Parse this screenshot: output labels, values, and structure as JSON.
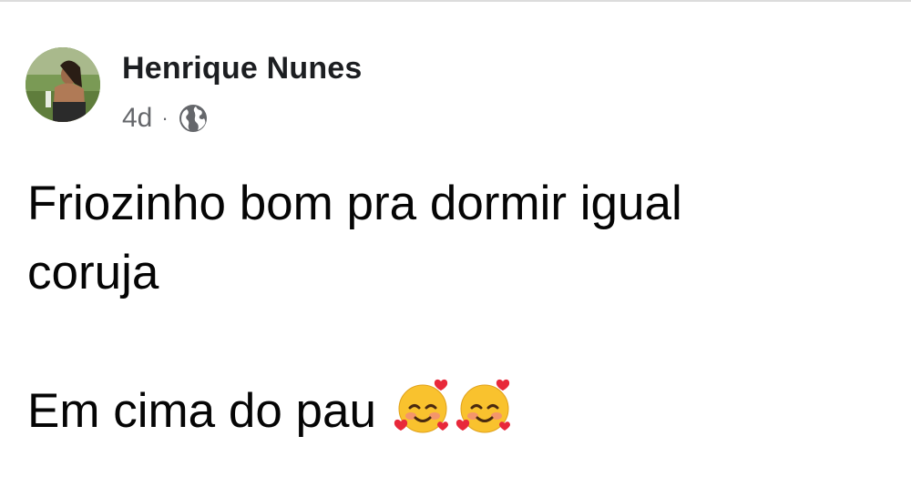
{
  "post": {
    "author_name": "Henrique Nunes",
    "timestamp": "4d",
    "separator": "·",
    "audience_icon": "globe-icon",
    "text_lines": [
      "Friozinho bom pra dormir igual",
      "coruja",
      "",
      "Em cima do pau"
    ],
    "emojis": [
      "smiling-face-with-hearts",
      "smiling-face-with-hearts"
    ]
  },
  "colors": {
    "name": "#1c1e21",
    "meta": "#65676b",
    "body_text": "#050505",
    "background": "#ffffff"
  }
}
